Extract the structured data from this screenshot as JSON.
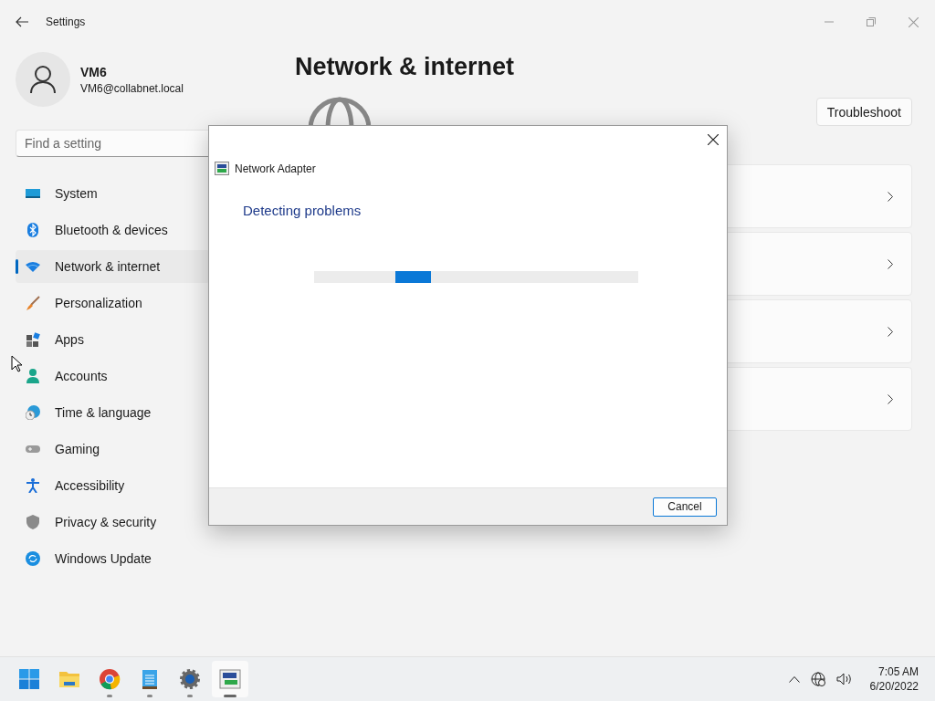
{
  "window": {
    "title": "Settings"
  },
  "user": {
    "name": "VM6",
    "email": "VM6@collabnet.local"
  },
  "search": {
    "placeholder": "Find a setting"
  },
  "nav": [
    {
      "label": "System",
      "kind": "system",
      "selected": false
    },
    {
      "label": "Bluetooth & devices",
      "kind": "bluetooth",
      "selected": false
    },
    {
      "label": "Network & internet",
      "kind": "wifi",
      "selected": true
    },
    {
      "label": "Personalization",
      "kind": "brush",
      "selected": false
    },
    {
      "label": "Apps",
      "kind": "apps",
      "selected": false
    },
    {
      "label": "Accounts",
      "kind": "person",
      "selected": false
    },
    {
      "label": "Time & language",
      "kind": "clock",
      "selected": false
    },
    {
      "label": "Gaming",
      "kind": "gamepad",
      "selected": false
    },
    {
      "label": "Accessibility",
      "kind": "accessibility",
      "selected": false
    },
    {
      "label": "Privacy & security",
      "kind": "shield",
      "selected": false
    },
    {
      "label": "Windows Update",
      "kind": "update",
      "selected": false
    }
  ],
  "page": {
    "title": "Network & internet",
    "troubleshoot_button": "Troubleshoot",
    "cards": [
      {
        "kind": "link"
      },
      {
        "kind": "link"
      },
      {
        "kind": "link"
      },
      {
        "kind": "link"
      }
    ]
  },
  "dialog": {
    "title": "Network Adapter",
    "heading": "Detecting problems",
    "progress": {
      "level": 0.36
    },
    "buttons": [
      "Cancel"
    ]
  },
  "taskbar": {
    "apps": [
      {
        "kind": "start",
        "running": false,
        "selected": false
      },
      {
        "kind": "folder",
        "running": false,
        "selected": false
      },
      {
        "kind": "browser",
        "running": true,
        "selected": false
      },
      {
        "kind": "notepad",
        "running": true,
        "selected": false
      },
      {
        "kind": "gear",
        "running": true,
        "selected": false
      },
      {
        "kind": "adapter",
        "running": true,
        "selected": true
      }
    ],
    "time": "7:05 AM",
    "date": "6/20/2022"
  }
}
